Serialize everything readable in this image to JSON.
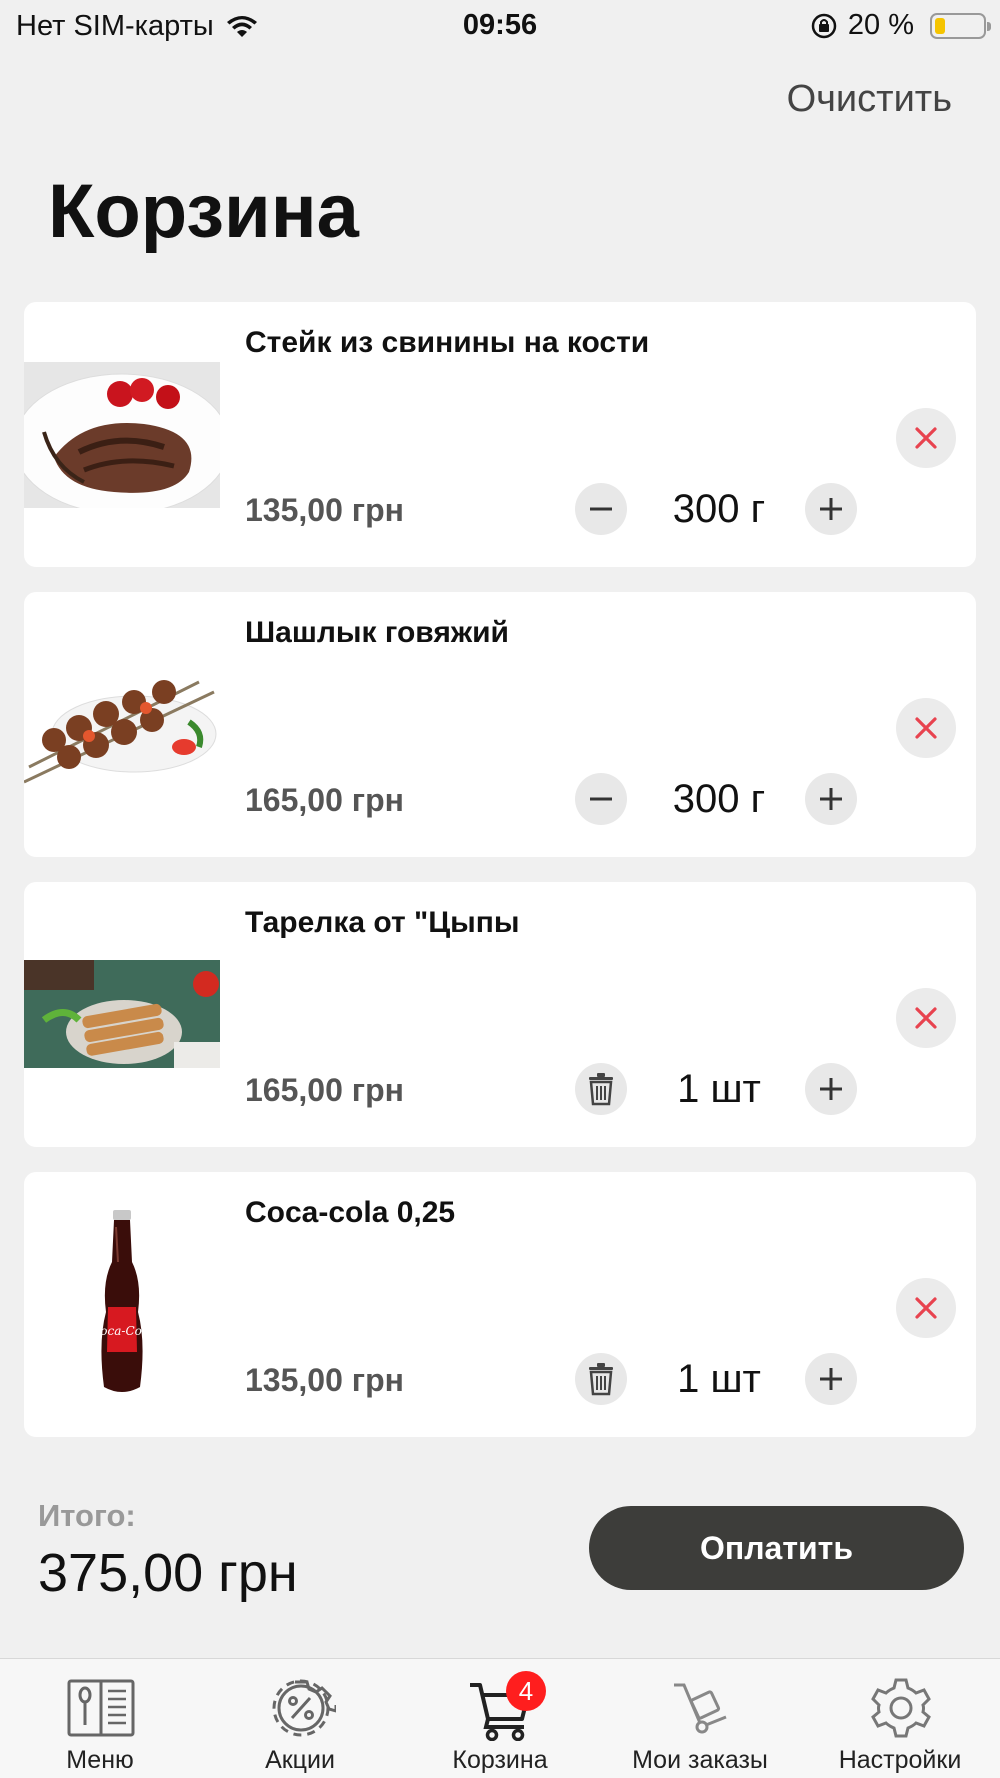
{
  "status_bar": {
    "carrier": "Нет SIM-карты",
    "time": "09:56",
    "battery": "20 %",
    "battery_level": 0.2
  },
  "header": {
    "clear_label": "Очистить",
    "title": "Корзина"
  },
  "cart": {
    "items": [
      {
        "name": "Стейк из свинины на кости",
        "price": "135,00 грн",
        "quantity": "300 г",
        "minus_control": "minus-icon",
        "image": "pork-steak-photo"
      },
      {
        "name": "Шашлык говяжий",
        "price": "165,00 грн",
        "quantity": "300 г",
        "minus_control": "minus-icon",
        "image": "beef-skewers-photo"
      },
      {
        "name": "Тарелка от \"Цыпы",
        "price": "165,00 грн",
        "quantity": "1 шт",
        "minus_control": "trash-icon",
        "image": "chicken-plate-photo"
      },
      {
        "name": "Coca-cola 0,25",
        "price": "135,00 грн",
        "quantity": "1 шт",
        "minus_control": "trash-icon",
        "image": "coca-cola-bottle-photo"
      }
    ]
  },
  "total": {
    "label": "Итого:",
    "value": "375,00 грн"
  },
  "pay_button": "Оплатить",
  "tabs": [
    {
      "label": "Меню",
      "icon": "menu-book-icon"
    },
    {
      "label": "Акции",
      "icon": "discount-gear-icon"
    },
    {
      "label": "Корзина",
      "icon": "cart-icon",
      "badge": "4"
    },
    {
      "label": "Мои заказы",
      "icon": "hand-truck-icon"
    },
    {
      "label": "Настройки",
      "icon": "settings-gear-icon"
    }
  ],
  "colors": {
    "background": "#f0f0f0",
    "card": "#ffffff",
    "accent_button": "#3d3d3a",
    "remove_icon": "#e8434f",
    "badge": "#ff1e1e",
    "battery_fill": "#f5c400"
  }
}
